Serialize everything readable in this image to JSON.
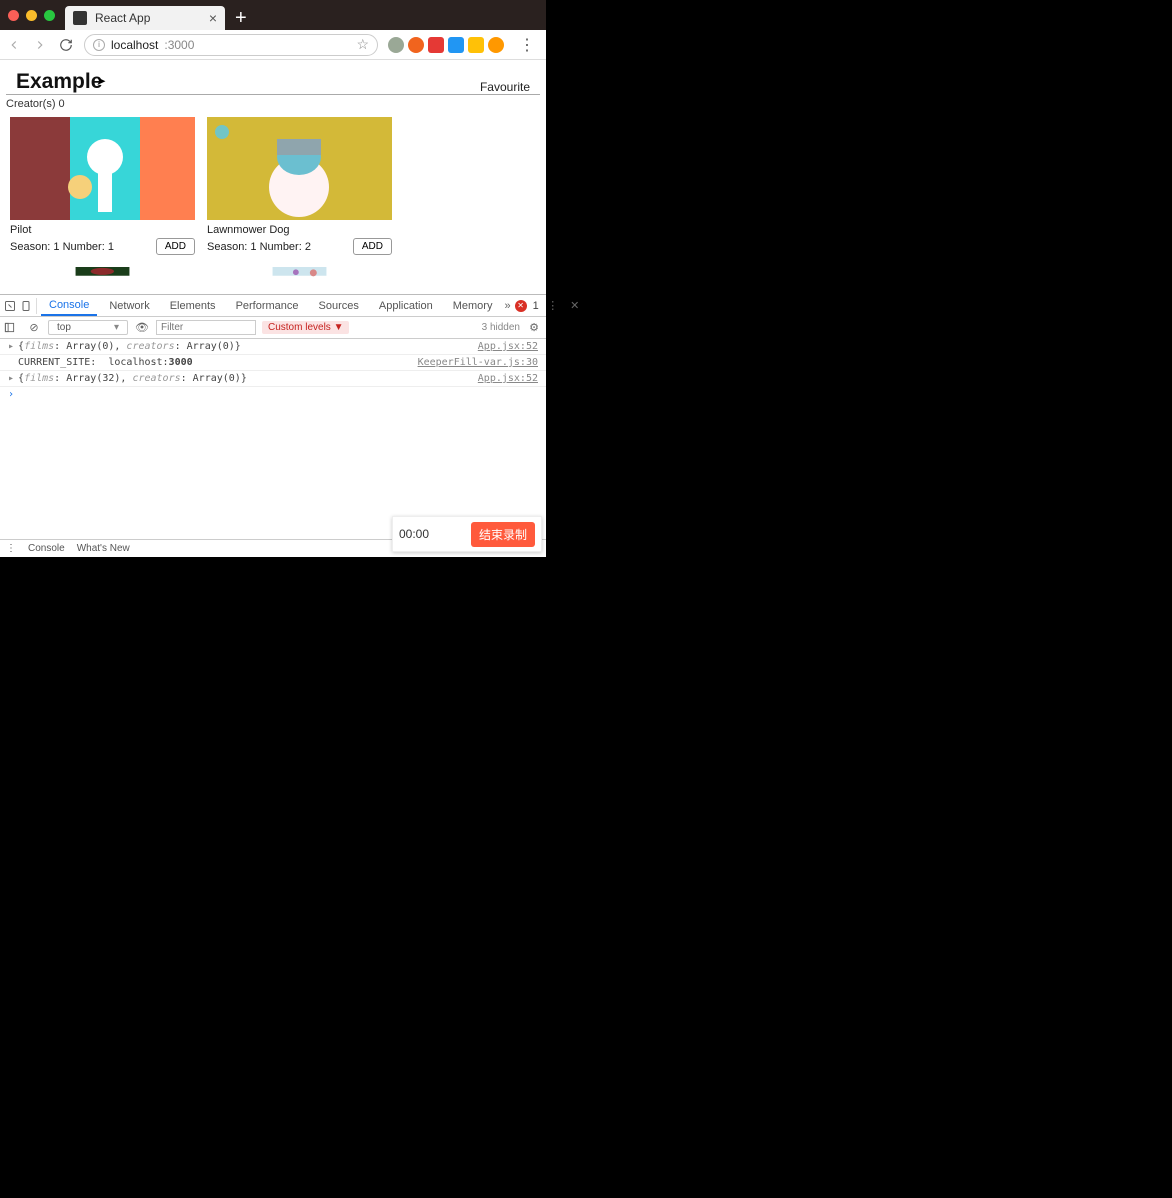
{
  "browser": {
    "tab_title": "React App",
    "url_host": "localhost",
    "url_port": ":3000"
  },
  "page": {
    "title": "Example",
    "favourite_link": "Favourite",
    "creators_label": "Creator(s) 0",
    "cards": [
      {
        "title": "Pilot",
        "meta": "Season: 1 Number: 1",
        "add": "ADD"
      },
      {
        "title": "Lawnmower Dog",
        "meta": "Season: 1 Number: 2",
        "add": "ADD"
      }
    ]
  },
  "devtools": {
    "tabs": [
      "Console",
      "Network",
      "Elements",
      "Performance",
      "Sources",
      "Application",
      "Memory"
    ],
    "error_count": "1",
    "scope": "top",
    "filter_placeholder": "Filter",
    "levels": "Custom levels ▼",
    "hidden": "3 hidden",
    "console": [
      {
        "expandable": true,
        "text": "{films: Array(0), creators: Array(0)}",
        "src": "App.jsx:52"
      },
      {
        "expandable": false,
        "text": "CURRENT_SITE:  localhost:3000",
        "src": "KeeperFill-var.js:30"
      },
      {
        "expandable": true,
        "text": "{films: Array(32), creators: Array(0)}",
        "src": "App.jsx:52"
      }
    ],
    "bottom_tabs": [
      "Console",
      "What's New"
    ]
  },
  "recording": {
    "time": "00:00",
    "stop_label": "结束录制"
  }
}
